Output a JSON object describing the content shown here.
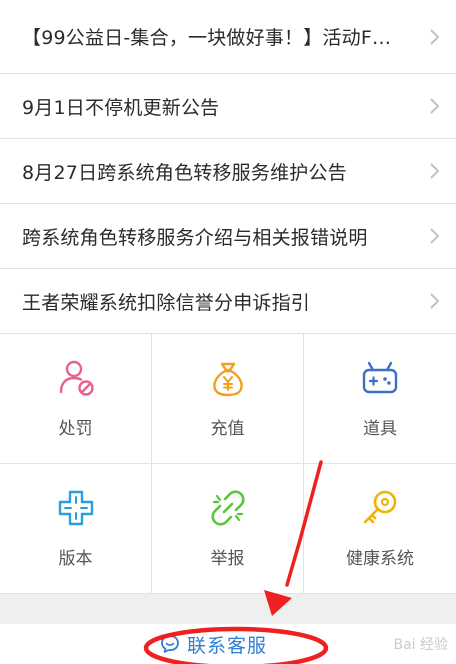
{
  "notices": [
    {
      "title": "【99公益日-集合，一块做好事！】活动F…"
    },
    {
      "title": "9月1日不停机更新公告"
    },
    {
      "title": "8月27日跨系统角色转移服务维护公告"
    },
    {
      "title": "跨系统角色转移服务介绍与相关报错说明"
    },
    {
      "title": "王者荣耀系统扣除信誉分申诉指引"
    }
  ],
  "services": [
    {
      "label": "处罚",
      "icon": "person-ban-icon",
      "color": "#e8618c"
    },
    {
      "label": "充值",
      "icon": "money-bag-icon",
      "color": "#f0a020"
    },
    {
      "label": "道具",
      "icon": "gamepad-icon",
      "color": "#3d6fc4"
    },
    {
      "label": "版本",
      "icon": "dpad-icon",
      "color": "#2aa0d8"
    },
    {
      "label": "举报",
      "icon": "broken-link-icon",
      "color": "#5cc43c"
    },
    {
      "label": "健康系统",
      "icon": "key-icon",
      "color": "#f0b400"
    }
  ],
  "contact": {
    "label": "联系客服",
    "icon": "chat-bubble-icon",
    "color": "#2e7fd6"
  },
  "annotation": {
    "color": "#ee2020"
  },
  "watermark": "Bai 经验"
}
